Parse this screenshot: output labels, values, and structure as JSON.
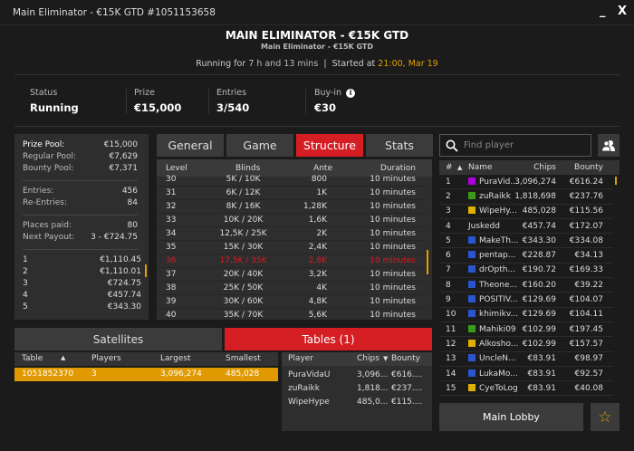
{
  "window": {
    "title": "Main Eliminator - €15K GTD #1051153658",
    "minimize": "_",
    "close": "X"
  },
  "header": {
    "title": "MAIN ELIMINATOR - €15K GTD",
    "subtitle": "Main Eliminator - €15K GTD",
    "running_label": "Running for",
    "running_value": "7 h and 13 mins",
    "separator": "|",
    "started_label": "Started at",
    "started_value": "21:00, Mar 19"
  },
  "summary": [
    {
      "label": "Status",
      "value": "Running"
    },
    {
      "label": "Prize",
      "value": "€15,000"
    },
    {
      "label": "Entries",
      "value": "3/540"
    },
    {
      "label": "Buy-in",
      "value": "€30",
      "info_icon": "info-icon"
    }
  ],
  "pool": {
    "groups": [
      [
        {
          "k": "Prize Pool:",
          "v": "€15,000"
        },
        {
          "k": "Regular Pool:",
          "v": "€7,629"
        },
        {
          "k": "Bounty Pool:",
          "v": "€7,371"
        }
      ],
      [
        {
          "k": "Entries:",
          "v": "456"
        },
        {
          "k": "Re-Entries:",
          "v": "84"
        }
      ],
      [
        {
          "k": "Places paid:",
          "v": "80"
        },
        {
          "k": "Next Payout:",
          "v": "3 - €724.75"
        }
      ]
    ],
    "payouts": [
      {
        "place": "1",
        "amount": "€1,110.45"
      },
      {
        "place": "2",
        "amount": "€1,110.01"
      },
      {
        "place": "3",
        "amount": "€724.75"
      },
      {
        "place": "4",
        "amount": "€457.74"
      },
      {
        "place": "5",
        "amount": "€343.30"
      }
    ]
  },
  "tabs": [
    {
      "label": "General",
      "active": false
    },
    {
      "label": "Game",
      "active": false
    },
    {
      "label": "Structure",
      "active": true
    },
    {
      "label": "Stats",
      "active": false
    }
  ],
  "structure": {
    "headers": [
      "Level",
      "Blinds",
      "Ante",
      "Duration"
    ],
    "current_level": "36",
    "rows": [
      [
        "30",
        "5K / 10K",
        "800",
        "10 minutes"
      ],
      [
        "31",
        "6K / 12K",
        "1K",
        "10 minutes"
      ],
      [
        "32",
        "8K / 16K",
        "1,28K",
        "10 minutes"
      ],
      [
        "33",
        "10K / 20K",
        "1,6K",
        "10 minutes"
      ],
      [
        "34",
        "12,5K / 25K",
        "2K",
        "10 minutes"
      ],
      [
        "35",
        "15K / 30K",
        "2,4K",
        "10 minutes"
      ],
      [
        "36",
        "17,5K / 35K",
        "2,8K",
        "10 minutes"
      ],
      [
        "37",
        "20K / 40K",
        "3,2K",
        "10 minutes"
      ],
      [
        "38",
        "25K / 50K",
        "4K",
        "10 minutes"
      ],
      [
        "39",
        "30K / 60K",
        "4,8K",
        "10 minutes"
      ],
      [
        "40",
        "35K / 70K",
        "5,6K",
        "10 minutes"
      ]
    ]
  },
  "bottom_tabs": [
    {
      "label": "Satellites",
      "active": false
    },
    {
      "label": "Tables (1)",
      "active": true
    }
  ],
  "tables": {
    "headers": [
      "Table",
      "Players",
      "Largest",
      "Smallest"
    ],
    "sort_icon": "sort-up-icon",
    "rows": [
      [
        "1051852370",
        "3",
        "3,096,274",
        "485,028"
      ]
    ]
  },
  "table_players": {
    "headers": [
      "Player",
      "Chips",
      "Bounty"
    ],
    "rows": [
      [
        "PuraVidaU",
        "3,096...",
        "€616...."
      ],
      [
        "zuRaikk",
        "1,818...",
        "€237...."
      ],
      [
        "WipeHype",
        "485,0...",
        "€115...."
      ]
    ]
  },
  "search": {
    "placeholder": "Find player"
  },
  "players": {
    "headers": [
      "#",
      "Name",
      "Chips",
      "Bounty"
    ],
    "rows": [
      {
        "rank": "1",
        "name": "PuraVid...",
        "chips": "3,096,274",
        "bounty": "€616.24",
        "color": "#b000e0"
      },
      {
        "rank": "2",
        "name": "zuRaikk",
        "chips": "1,818,698",
        "bounty": "€237.76",
        "color": "#3a9a1a"
      },
      {
        "rank": "3",
        "name": "WipeHy...",
        "chips": "485,028",
        "bounty": "€115.56",
        "color": "#e0b000"
      },
      {
        "rank": "4",
        "name": "Juskedd",
        "chips": "€457.74",
        "bounty": "€172.07",
        "color": ""
      },
      {
        "rank": "5",
        "name": "MakeTh...",
        "chips": "€343.30",
        "bounty": "€334.08",
        "color": "#2a55d0"
      },
      {
        "rank": "6",
        "name": "pentap...",
        "chips": "€228.87",
        "bounty": "€34.13",
        "color": "#2a55d0"
      },
      {
        "rank": "7",
        "name": "drOpth...",
        "chips": "€190.72",
        "bounty": "€169.33",
        "color": "#2a55d0"
      },
      {
        "rank": "8",
        "name": "Theone...",
        "chips": "€160.20",
        "bounty": "€39.22",
        "color": "#2a55d0"
      },
      {
        "rank": "9",
        "name": "POSITIV...",
        "chips": "€129.69",
        "bounty": "€104.07",
        "color": "#2a55d0"
      },
      {
        "rank": "10",
        "name": "khimikv...",
        "chips": "€129.69",
        "bounty": "€104.11",
        "color": "#2a55d0"
      },
      {
        "rank": "11",
        "name": "Mahiki09",
        "chips": "€102.99",
        "bounty": "€197.45",
        "color": "#3a9a1a"
      },
      {
        "rank": "12",
        "name": "Alkosho...",
        "chips": "€102.99",
        "bounty": "€157.57",
        "color": "#e0b000"
      },
      {
        "rank": "13",
        "name": "UncleN...",
        "chips": "€83.91",
        "bounty": "€98.97",
        "color": "#2a55d0"
      },
      {
        "rank": "14",
        "name": "LukaMo...",
        "chips": "€83.91",
        "bounty": "€92.57",
        "color": "#2a55d0"
      },
      {
        "rank": "15",
        "name": "CyeToLog",
        "chips": "€83.91",
        "bounty": "€40.08",
        "color": "#e0b000"
      }
    ]
  },
  "main_lobby": "Main Lobby",
  "colors": {
    "accent": "#d41e24",
    "highlight": "#e09a00",
    "started": "#e0a000"
  }
}
